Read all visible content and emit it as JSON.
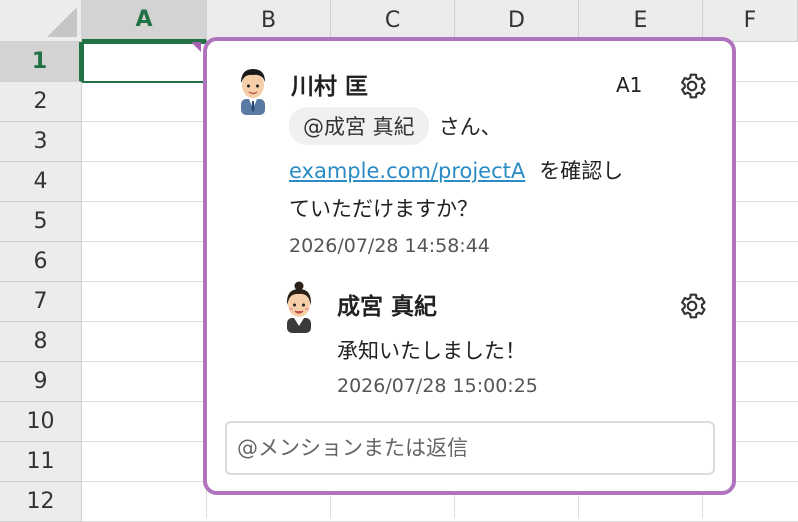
{
  "sheet": {
    "columns": [
      "A",
      "B",
      "C",
      "D",
      "E",
      "F"
    ],
    "rows": [
      "1",
      "2",
      "3",
      "4",
      "5",
      "6",
      "7",
      "8",
      "9",
      "10",
      "11",
      "12"
    ],
    "active_column": "A",
    "active_row": "1"
  },
  "comment": {
    "cell_ref": "A1",
    "thread": [
      {
        "author": "川村 匡",
        "avatar": "man-avatar-icon",
        "mention": "@成宮 真紀",
        "text_after_mention": "さん、",
        "link": "example.com/projectA",
        "text_after_link": "を確認し",
        "text_line3": "ていただけますか？",
        "timestamp": "2026/07/28 14:58:44"
      },
      {
        "author": "成宮 真紀",
        "avatar": "woman-avatar-icon",
        "text": "承知いたしました！",
        "timestamp": "2026/07/28 15:00:25"
      }
    ],
    "reply_placeholder": "@メンションまたは返信"
  },
  "colors": {
    "accent": "#217346",
    "popup_border": "#b073bd",
    "link": "#2a8bc5"
  }
}
